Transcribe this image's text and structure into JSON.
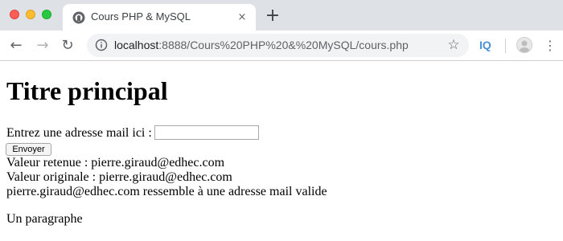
{
  "window": {
    "tab_title": "Cours PHP & MySQL",
    "tab_close_glyph": "×",
    "new_tab_glyph": "+"
  },
  "toolbar": {
    "back_glyph": "←",
    "forward_glyph": "→",
    "reload_glyph": "↻",
    "url_host": "localhost",
    "url_rest": ":8888/Cours%20PHP%20&%20MySQL/cours.php",
    "star_glyph": "☆",
    "extension_label": "IQ",
    "menu_glyph": "⋮"
  },
  "page": {
    "heading": "Titre principal",
    "form": {
      "label": "Entrez une adresse mail ici :",
      "email_value": "",
      "submit_label": "Envoyer"
    },
    "result_retained": "Valeur retenue : pierre.giraud@edhec.com",
    "result_original": "Valeur originale : pierre.giraud@edhec.com",
    "result_validity": "pierre.giraud@edhec.com ressemble à une adresse mail valide",
    "paragraph": "Un paragraphe"
  },
  "icons": {
    "favicon": "php-favicon-icon",
    "info": "info-icon",
    "profile": "profile-avatar-icon"
  },
  "colors": {
    "tabstrip": "#dee1e6",
    "omnibox": "#f1f3f4",
    "close_dot": "#fd5f57",
    "minimize_dot": "#febc2e",
    "maximize_dot": "#28c840",
    "extension": "#4a90d9"
  }
}
